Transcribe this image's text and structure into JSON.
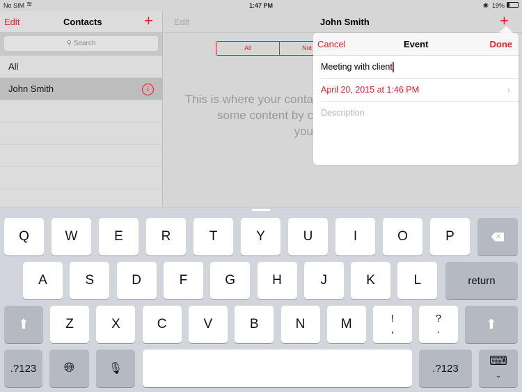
{
  "status": {
    "carrier": "No SIM",
    "time": "1:47 PM",
    "battery": "19%"
  },
  "left": {
    "edit": "Edit",
    "title": "Contacts",
    "search_placeholder": "Search",
    "items": [
      {
        "label": "All"
      },
      {
        "label": "John Smith",
        "selected": true
      }
    ]
  },
  "right": {
    "edit": "Edit",
    "title": "John Smith",
    "segments": [
      "All",
      "Not"
    ],
    "empty_text_lines": [
      "This is where your conta",
      "some content by c",
      "you"
    ]
  },
  "popover": {
    "cancel": "Cancel",
    "title": "Event",
    "done": "Done",
    "title_value": "Meeting with client",
    "date": "April 20, 2015 at 1:46 PM",
    "description_placeholder": "Description"
  },
  "keyboard": {
    "row1": [
      "Q",
      "W",
      "E",
      "R",
      "T",
      "Y",
      "U",
      "I",
      "O",
      "P"
    ],
    "row2": [
      "A",
      "S",
      "D",
      "F",
      "G",
      "H",
      "J",
      "K",
      "L"
    ],
    "return": "return",
    "row3": [
      "Z",
      "X",
      "C",
      "V",
      "B",
      "N",
      "M"
    ],
    "punct1": [
      "!",
      ","
    ],
    "punct2": [
      "?",
      "."
    ],
    "numbers": ".?123"
  },
  "colors": {
    "accent": "#e0232b"
  }
}
